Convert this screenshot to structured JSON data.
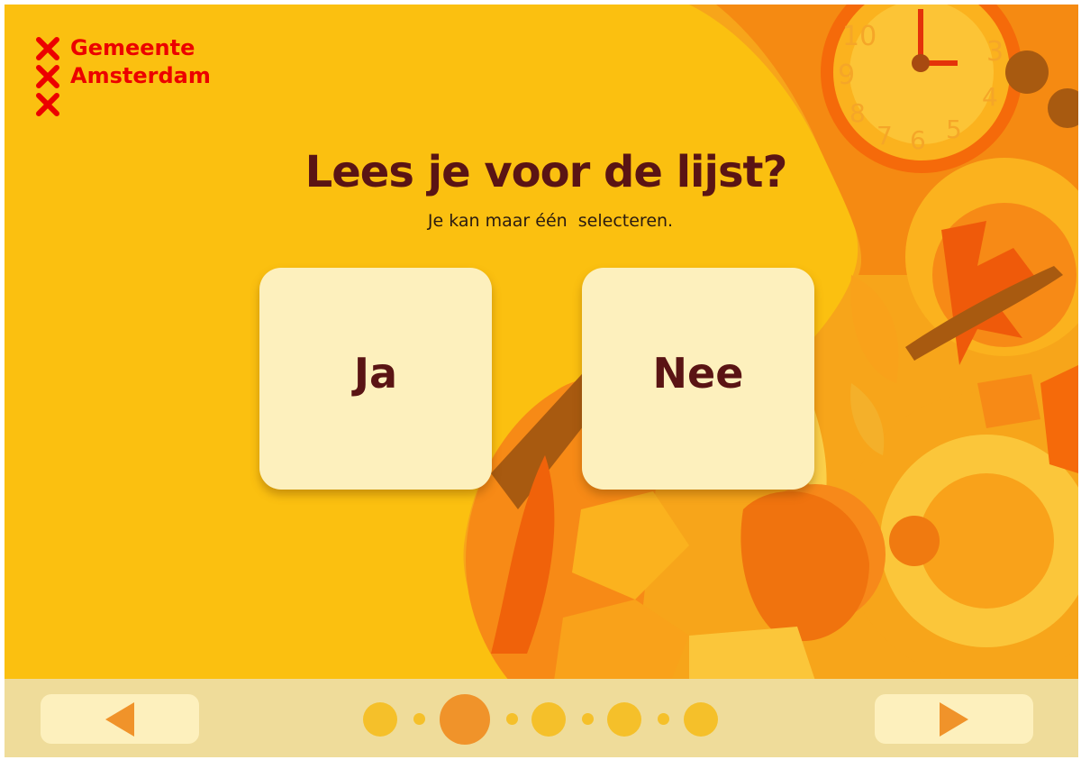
{
  "brand": {
    "lines": [
      "Gemeente",
      "Amsterdam",
      ""
    ],
    "color": "#ec0000",
    "icon": "st-andrew-cross-icon"
  },
  "question": {
    "title": "Lees je voor de lijst?",
    "hint": "Je kan maar één  selecteren."
  },
  "options": [
    {
      "label": "Ja"
    },
    {
      "label": "Nee"
    }
  ],
  "navigation": {
    "prev_icon": "triangle-left-icon",
    "next_icon": "triangle-right-icon",
    "steps_total": 5,
    "current_step": 2
  },
  "colors": {
    "background": "#fbc010",
    "card": "#fdf0bd",
    "text_dark": "#5a1414",
    "accent": "#f0932a",
    "footer": "#efdc9a"
  }
}
